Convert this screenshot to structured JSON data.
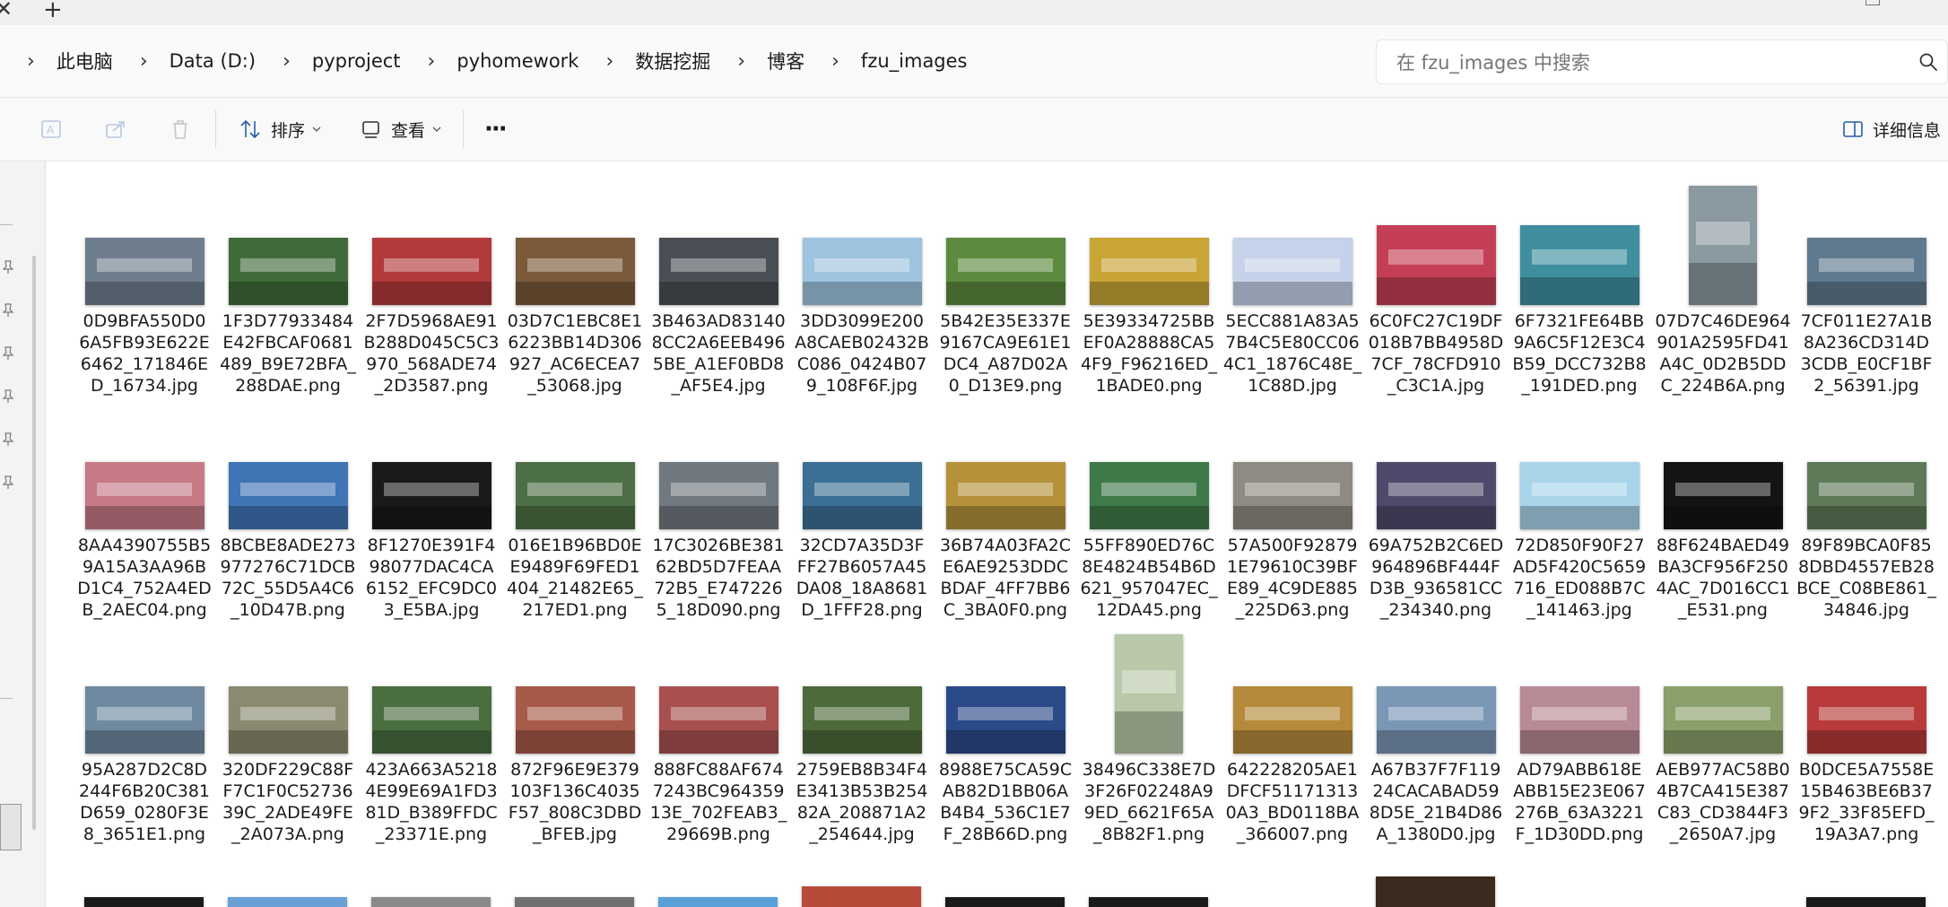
{
  "window": {
    "close_glyph": "✕",
    "new_tab_glyph": "+"
  },
  "address": {
    "crumbs": [
      "此电脑",
      "Data (D:)",
      "pyproject",
      "pyhomework",
      "数据挖掘",
      "博客",
      "fzu_images"
    ],
    "separator": "›"
  },
  "search": {
    "placeholder": "在 fzu_images 中搜索"
  },
  "toolbar": {
    "sort_label": "排序",
    "view_label": "查看",
    "more_label": "···",
    "details_label": "详细信息"
  },
  "files": [
    {
      "name": "0D9BFA550D06A5FB93E622E6462_171846ED_16734.jpg",
      "lines": [
        "0D9BFA550D0",
        "6A5FB93E622E",
        "6462_171846E",
        "D_16734.jpg"
      ],
      "color": "#6f7e8f",
      "shape": "wide"
    },
    {
      "name": "1F3D77933484E42FBCAF0681489_B9E72BFA_288DAE.png",
      "lines": [
        "1F3D77933484",
        "E42FBCAF0681",
        "489_B9E72BFA_",
        "288DAE.png"
      ],
      "color": "#3f6b3a",
      "shape": "wide"
    },
    {
      "name": "2F7D5968AE91B288D045C5C3970_568ADE74_2D3587.png",
      "lines": [
        "2F7D5968AE91",
        "B288D045C5C3",
        "970_568ADE74",
        "_2D3587.png"
      ],
      "color": "#b23a3a",
      "shape": "wide"
    },
    {
      "name": "03D7C1EBC8E16223BB14D306927_AC6ECEA7_53068.jpg",
      "lines": [
        "03D7C1EBC8E1",
        "6223BB14D306",
        "927_AC6ECEA7",
        "_53068.jpg"
      ],
      "color": "#7a5a3a",
      "shape": "wide"
    },
    {
      "name": "3B463AD831408CC2A6EEB4965BE_A1EF0BD8_AF5E4.jpg",
      "lines": [
        "3B463AD83140",
        "8CC2A6EEB496",
        "5BE_A1EF0BD8",
        "_AF5E4.jpg"
      ],
      "color": "#4a4f55",
      "shape": "wide"
    },
    {
      "name": "3DD3099E200A8CAEB02432BC086_0424B079_108F6F.jpg",
      "lines": [
        "3DD3099E200",
        "A8CAEB02432B",
        "C086_0424B07",
        "9_108F6F.jpg"
      ],
      "color": "#9ec4df",
      "shape": "wide"
    },
    {
      "name": "5B42E35E337E9167CA9E61E1DC4_A87D02A0_D13E9.png",
      "lines": [
        "5B42E35E337E",
        "9167CA9E61E1",
        "DC4_A87D02A",
        "0_D13E9.png"
      ],
      "color": "#5c8a3e",
      "shape": "wide"
    },
    {
      "name": "5E39334725BBEF0A28888CA54F9_F96216ED_1BADE0.png",
      "lines": [
        "5E39334725BB",
        "EF0A28888CA5",
        "4F9_F96216ED_",
        "1BADE0.png"
      ],
      "color": "#c9a437",
      "shape": "wide"
    },
    {
      "name": "5ECC881A83A57B4C5E80CC064C1_1876C48E_1C88D.jpg",
      "lines": [
        "5ECC881A83A5",
        "7B4C5E80CC06",
        "4C1_1876C48E_",
        "1C88D.jpg"
      ],
      "color": "#c6d2ea",
      "shape": "wide"
    },
    {
      "name": "6C0FC27C19DF018B7BB4958D7CF_78CFD910_C3C1A.jpg",
      "lines": [
        "6C0FC27C19DF",
        "018B7BB4958D",
        "7CF_78CFD910",
        "_C3C1A.jpg"
      ],
      "color": "#c43f55",
      "shape": "tall4"
    },
    {
      "name": "6F7321FE64BB9A6C5F12E3C4B59_DCC732B8_191DED.png",
      "lines": [
        "6F7321FE64BB",
        "9A6C5F12E3C4",
        "B59_DCC732B8",
        "_191DED.png"
      ],
      "color": "#3f8fa0",
      "shape": "tall4"
    },
    {
      "name": "07D7C46DE964901A2595FD41A4C_0D2B5DDC_224B6A.png",
      "lines": [
        "07D7C46DE964",
        "901A2595FD41",
        "A4C_0D2B5DD",
        "C_224B6A.png"
      ],
      "color": "#8a9aa0",
      "shape": "portrait"
    },
    {
      "name": "7CF011E27A1B8A236CD314D3CDB_E0CF1BF2_56391.jpg",
      "lines": [
        "7CF011E27A1B",
        "8A236CD314D",
        "3CDB_E0CF1BF",
        "2_56391.jpg"
      ],
      "color": "#5f7a8f",
      "shape": "wide"
    },
    {
      "name": "8AA4390755B59A15A3AA96BD1C4_752A4EDB_2AEC04.png",
      "lines": [
        "8AA4390755B5",
        "9A15A3AA96B",
        "D1C4_752A4ED",
        "B_2AEC04.png"
      ],
      "color": "#c77a86",
      "shape": "wide"
    },
    {
      "name": "8BCBE8ADE273977276C71DCB72C_55D5A4C6_10D47B.png",
      "lines": [
        "8BCBE8ADE273",
        "977276C71DCB",
        "72C_55D5A4C6",
        "_10D47B.png"
      ],
      "color": "#3f74b5",
      "shape": "wide"
    },
    {
      "name": "8F1270E391F498077DAC4CA6152_EFC9DC03_E5BA.jpg",
      "lines": [
        "8F1270E391F4",
        "98077DAC4CA",
        "6152_EFC9DC0",
        "3_E5BA.jpg"
      ],
      "color": "#1a1a1a",
      "shape": "wide"
    },
    {
      "name": "016E1B96BD0EE9489F69FED1404_21482E65_217ED1.png",
      "lines": [
        "016E1B96BD0E",
        "E9489F69FED1",
        "404_21482E65_",
        "217ED1.png"
      ],
      "color": "#4d6f45",
      "shape": "wide"
    },
    {
      "name": "17C3026BE38162BD5D7FEAA72B5_E7472265_18D090.png",
      "lines": [
        "17C3026BE381",
        "62BD5D7FEAA",
        "72B5_E747226",
        "5_18D090.png"
      ],
      "color": "#707880",
      "shape": "wide"
    },
    {
      "name": "32CD7A35D3FFF27B6057A45DA08_18A8681D_1FFF28.png",
      "lines": [
        "32CD7A35D3F",
        "FF27B6057A45",
        "DA08_18A8681",
        "D_1FFF28.png"
      ],
      "color": "#3b6f94",
      "shape": "wide"
    },
    {
      "name": "36B74A03FA2CE6AE9253DDCBDAF_4FF7BB6C_3BA0F0.png",
      "lines": [
        "36B74A03FA2C",
        "E6AE9253DDC",
        "BDAF_4FF7BB6",
        "C_3BA0F0.png"
      ],
      "color": "#b5923a",
      "shape": "wide"
    },
    {
      "name": "55FF890ED76C8E4824B54B6D621_957047EC_12DA45.png",
      "lines": [
        "55FF890ED76C",
        "8E4824B54B6D",
        "621_957047EC_",
        "12DA45.png"
      ],
      "color": "#3f7a4a",
      "shape": "wide"
    },
    {
      "name": "57A500F928791E79610C39BFE89_4C9DE885_225D63.png",
      "lines": [
        "57A500F92879",
        "1E79610C39BF",
        "E89_4C9DE885",
        "_225D63.png"
      ],
      "color": "#8f8a82",
      "shape": "wide"
    },
    {
      "name": "69A752B2C6ED964896BF444FD3B_936581CC_234340.png",
      "lines": [
        "69A752B2C6ED",
        "964896BF444F",
        "D3B_936581CC",
        "_234340.png"
      ],
      "color": "#4f4a6b",
      "shape": "wide"
    },
    {
      "name": "72D850F90F27AD5F420C5659716_ED088B7C_141463.jpg",
      "lines": [
        "72D850F90F27",
        "AD5F420C5659",
        "716_ED088B7C",
        "_141463.jpg"
      ],
      "color": "#a8d4ea",
      "shape": "wide"
    },
    {
      "name": "88F624BAED49BA3CF956F2504AC_7D016CC1_E531.png",
      "lines": [
        "88F624BAED49",
        "BA3CF956F250",
        "4AC_7D016CC1",
        "_E531.png"
      ],
      "color": "#141414",
      "shape": "wide"
    },
    {
      "name": "89F89BCA0F858DBD4557EB28BCE_C08BE861_34846.jpg",
      "lines": [
        "89F89BCA0F85",
        "8DBD4557EB28",
        "BCE_C08BE861_",
        "34846.jpg"
      ],
      "color": "#5f7a58",
      "shape": "wide"
    },
    {
      "name": "95A287D2C8D244F6B20C381D659_0280F3E8_3651E1.png",
      "lines": [
        "95A287D2C8D",
        "244F6B20C381",
        "D659_0280F3E",
        "8_3651E1.png"
      ],
      "color": "#6f8aa0",
      "shape": "wide"
    },
    {
      "name": "320DF229C88FF7C1F0C52736390C_2ADE49FE_2A073A.png",
      "lines": [
        "320DF229C88F",
        "F7C1F0C52736",
        "39C_2ADE49FE",
        "_2A073A.png"
      ],
      "color": "#8a8a70",
      "shape": "wide"
    },
    {
      "name": "423A663A52184E99E69A1FD381D_B389FFDC_23371E.png",
      "lines": [
        "423A663A5218",
        "4E99E69A1FD3",
        "81D_B389FFDC",
        "_23371E.png"
      ],
      "color": "#4a6e40",
      "shape": "wide"
    },
    {
      "name": "872F96E9E379103F136C4035F57_808C3DBD_BFEB.jpg",
      "lines": [
        "872F96E9E379",
        "103F136C4035",
        "F57_808C3DBD",
        "_BFEB.jpg"
      ],
      "color": "#a85a4a",
      "shape": "wide"
    },
    {
      "name": "888FC88AF6747243BC96435913E_702FEAB3_29669B.png",
      "lines": [
        "888FC88AF674",
        "7243BC964359",
        "13E_702FEAB3_",
        "29669B.png"
      ],
      "color": "#a85050",
      "shape": "wide"
    },
    {
      "name": "2759EB8B34F4E3413B53B25482A_208871A2_254644.jpg",
      "lines": [
        "2759EB8B34F4",
        "E3413B53B254",
        "82A_208871A2",
        "_254644.jpg"
      ],
      "color": "#4d6a3a",
      "shape": "wide"
    },
    {
      "name": "8988E75CA59CAB82D1BB06AB4B4_536C1E7F_28B66D.png",
      "lines": [
        "8988E75CA59C",
        "AB82D1BB06A",
        "B4B4_536C1E7",
        "F_28B66D.png"
      ],
      "color": "#2b4a8a",
      "shape": "wide"
    },
    {
      "name": "38496C338E7D3F26F02248A99ED_6621F65A_8B82F1.png",
      "lines": [
        "38496C338E7D",
        "3F26F02248A9",
        "9ED_6621F65A",
        "_8B82F1.png"
      ],
      "color": "#b8c8a8",
      "shape": "portrait"
    },
    {
      "name": "642228205AE1DFCF511713130A3_BD0118BA_366007.png",
      "lines": [
        "642228205AE1",
        "DFCF51171313",
        "0A3_BD0118BA",
        "_366007.png"
      ],
      "color": "#b58a3a",
      "shape": "wide"
    },
    {
      "name": "A67B37F7F11924CACABAD598D5E_21B4D86A_1380D0.jpg",
      "lines": [
        "A67B37F7F119",
        "24CACABAD59",
        "8D5E_21B4D86",
        "A_1380D0.jpg"
      ],
      "color": "#7a96b5",
      "shape": "wide"
    },
    {
      "name": "AD79ABB618EABB15E23E067276B_63A3221F_1D30DD.png",
      "lines": [
        "AD79ABB618E",
        "ABB15E23E067",
        "276B_63A3221",
        "F_1D30DD.png"
      ],
      "color": "#b88a95",
      "shape": "wide"
    },
    {
      "name": "AEB977AC58B04B7CA415E387C83_CD3844F3_2650A7.jpg",
      "lines": [
        "AEB977AC58B0",
        "4B7CA415E387",
        "C83_CD3844F3",
        "_2650A7.jpg"
      ],
      "color": "#8aa06a",
      "shape": "wide"
    },
    {
      "name": "B0DCE5A7558E15B463BE6B379F2_33F85EFD_19A3A7.png",
      "lines": [
        "B0DCE5A7558E",
        "15B463BE6B37",
        "9F2_33F85EFD_",
        "19A3A7.png"
      ],
      "color": "#b83a3a",
      "shape": "wide"
    }
  ],
  "partial_row_colors": [
    "#1a1a1a",
    "#6aa0d8",
    "#8a8a8a",
    "#707070",
    "#5aa0d8",
    "#b84a3a",
    "#1a1a1a",
    "#1a1a1a",
    "#3a2a20",
    "#1a1a1a"
  ]
}
